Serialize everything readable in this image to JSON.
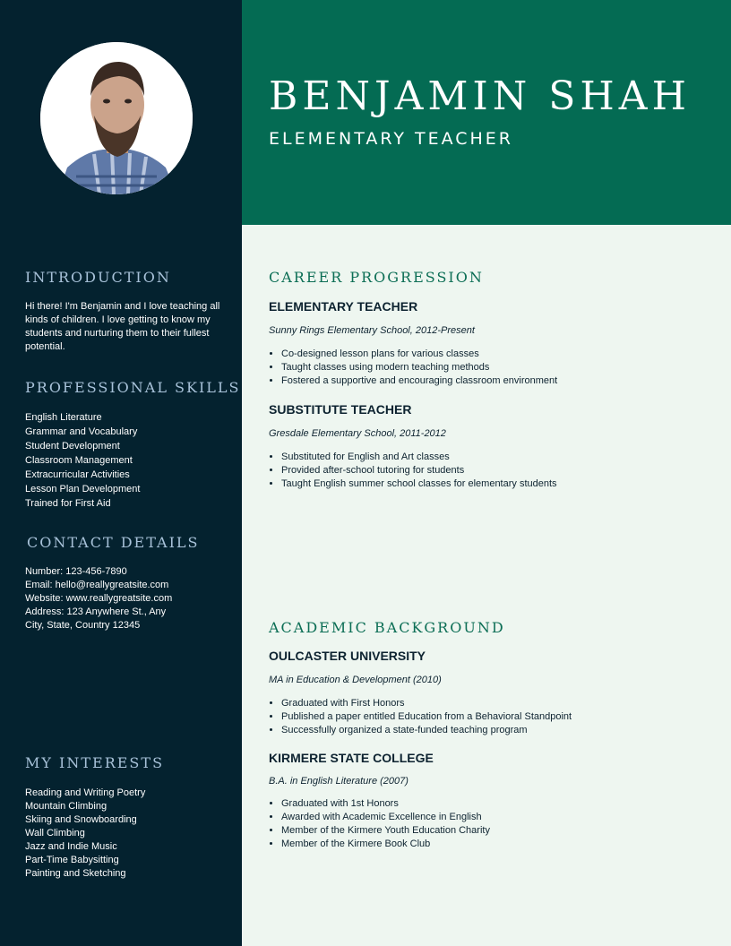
{
  "header": {
    "name": "BENJAMIN SHAH",
    "role": "ELEMENTARY TEACHER"
  },
  "sidebar": {
    "introduction": {
      "heading": "INTRODUCTION",
      "text": "Hi there! I'm Benjamin and I love teaching all kinds of children. I love getting to know my students and nurturing them to their fullest potential."
    },
    "skills": {
      "heading": "PROFESSIONAL SKILLS",
      "items": [
        "English Literature",
        "Grammar and Vocabulary",
        "Student Development",
        "Classroom Management",
        "Extracurricular Activities",
        "Lesson Plan Development",
        "Trained for First Aid"
      ]
    },
    "contact": {
      "heading": "CONTACT DETAILS",
      "number": "Number: 123-456-7890",
      "email": "Email: hello@reallygreatsite.com",
      "website": "Website: www.reallygreatsite.com",
      "address": "Address: 123 Anywhere St., Any City, State, Country 12345"
    },
    "interests": {
      "heading": "MY INTERESTS",
      "items": [
        "Reading and Writing Poetry",
        "Mountain Climbing",
        "Skiing and Snowboarding",
        "Wall Climbing",
        "Jazz and Indie Music",
        "Part-Time Babysitting",
        "Painting and Sketching"
      ]
    }
  },
  "career": {
    "heading": "CAREER PROGRESSION",
    "jobs": [
      {
        "title": "ELEMENTARY TEACHER",
        "subtitle": "Sunny Rings Elementary School, 2012-Present",
        "bullets": [
          "Co-designed lesson plans for various classes",
          "Taught classes using modern teaching methods",
          "Fostered a supportive and encouraging classroom environment"
        ]
      },
      {
        "title": "SUBSTITUTE TEACHER",
        "subtitle": "Gresdale Elementary School, 2011-2012",
        "bullets": [
          "Substituted for English and Art classes",
          "Provided after-school tutoring for students",
          "Taught English summer school classes for elementary students"
        ]
      }
    ]
  },
  "academic": {
    "heading": "ACADEMIC BACKGROUND",
    "schools": [
      {
        "title": "OULCASTER UNIVERSITY",
        "subtitle": "MA in Education & Development (2010)",
        "bullets": [
          "Graduated with First Honors",
          "Published a paper entitled Education from a Behavioral Standpoint",
          "Successfully organized a state-funded teaching program"
        ]
      },
      {
        "title": "KIRMERE STATE COLLEGE",
        "subtitle": "B.A. in English Literature (2007)",
        "bullets": [
          "Graduated with 1st Honors",
          "Awarded with Academic Excellence in English",
          "Member of the Kirmere Youth Education Charity",
          "Member of the Kirmere Book Club"
        ]
      }
    ]
  },
  "colors": {
    "sidebar": "#04222f",
    "header": "#046b53",
    "main": "#eef6f0",
    "accent": "#0c6e55",
    "side_heading": "#a8c2d9"
  }
}
